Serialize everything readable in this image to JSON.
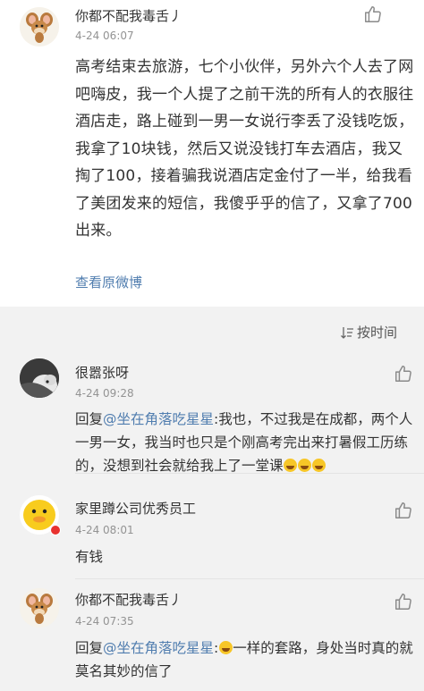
{
  "post": {
    "username": "你都不配我毒舌丿",
    "time": "4-24 06:07",
    "body": "高考结束去旅游，七个小伙伴，另外六个人去了网吧嗨皮，我一个人提了之前干洗的所有人的衣服往酒店走，路上碰到一男一女说行李丢了没钱吃饭，我拿了10块钱，然后又说没钱打车去酒店，我又掏了100，接着骗我说酒店定金付了一半，给我看了美团发来的短信，我傻乎乎的信了，又拿了700出来。",
    "view_original": "查看原微博",
    "like_icon": "thumb-up-icon"
  },
  "sort": {
    "label": "按时间",
    "icon": "sort-icon"
  },
  "comments": [
    {
      "username": "很嚣张呀",
      "time": "4-24 09:28",
      "reply_prefix": "回复",
      "mention": "@坐在角落吃星星",
      "text": ":我也，不过我是在成都，两个人一男一女，我当时也只是个刚高考完出来打暑假工历练的，没想到社会就给我上了一堂课",
      "emoji_count": 3
    },
    {
      "username": "家里蹲公司优秀员工",
      "time": "4-24 08:01",
      "text": "有钱"
    },
    {
      "username": "你都不配我毒舌丿",
      "time": "4-24 07:35",
      "reply_prefix": "回复",
      "mention": "@坐在角落吃星星",
      "text_after_emoji": "一样的套路，身处当时真的就莫名其妙的信了",
      "colon": ":"
    }
  ],
  "colors": {
    "link": "#507daf",
    "bg_comments": "#f2f2f2",
    "time": "#939393"
  }
}
